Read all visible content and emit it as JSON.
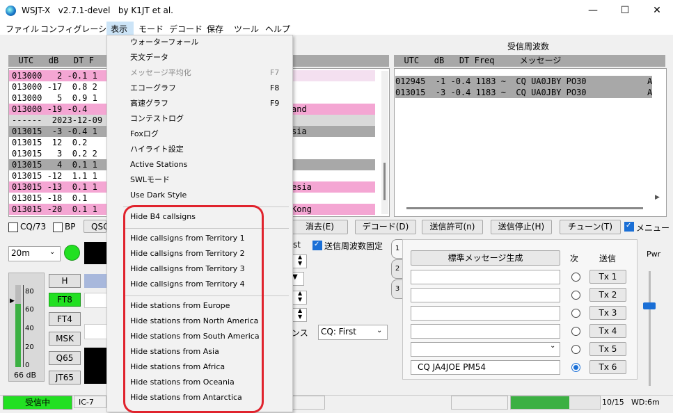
{
  "window": {
    "title": "WSJT-X   v2.7.1-devel   by K1JT et al.",
    "controls": [
      "—",
      "☐",
      "✕"
    ]
  },
  "menubar": [
    "ファイル",
    "コンフィグレーション",
    "表示",
    "モード",
    "デコード",
    "保存",
    "ツール",
    "ヘルプ"
  ],
  "band_activity": {
    "header": "  UTC   dB   DT F",
    "rows": [
      {
        "text": "013000   2 -0.1 1",
        "bg": "#f4a6d3"
      },
      {
        "text": "013000 -17  0.8 2",
        "bg": "#ffffff"
      },
      {
        "text": "013000   5  0.9 1",
        "bg": "#ffffff"
      },
      {
        "text": "013000 -19 -0.4  ",
        "bg": "#f4a6d3"
      },
      {
        "text": "------  2023-12-09",
        "bg": "#d9d9d9"
      },
      {
        "text": "013015  -3 -0.4 1",
        "bg": "#a8a8a8"
      },
      {
        "text": "013015  12  0.2  ",
        "bg": "#ffffff"
      },
      {
        "text": "013015   3  0.2 2",
        "bg": "#ffffff"
      },
      {
        "text": "013015   4  0.1 1",
        "bg": "#a8a8a8"
      },
      {
        "text": "013015 -12  1.1 1",
        "bg": "#ffffff"
      },
      {
        "text": "013015 -13  0.1 1",
        "bg": "#f4a6d3"
      },
      {
        "text": "013015 -18  0.1  ",
        "bg": "#ffffff"
      },
      {
        "text": "013015 -20  0.1 1",
        "bg": "#f4a6d3"
      }
    ],
    "right_fragments": [
      {
        "text": "",
        "bg": "#f4e0f0"
      },
      {
        "text": "",
        "bg": "#ffffff"
      },
      {
        "text": "",
        "bg": "#ffffff"
      },
      {
        "text": "and",
        "bg": "#f4a6d3"
      },
      {
        "text": "",
        "bg": "#d9d9d9"
      },
      {
        "text": "sia",
        "bg": "#a8a8a8"
      },
      {
        "text": "",
        "bg": "#ffffff"
      },
      {
        "text": "",
        "bg": "#ffffff"
      },
      {
        "text": "",
        "bg": "#a8a8a8"
      },
      {
        "text": "",
        "bg": "#ffffff"
      },
      {
        "text": "esia",
        "bg": "#f4a6d3"
      },
      {
        "text": "",
        "bg": "#ffffff"
      },
      {
        "text": "Kong",
        "bg": "#f4a6d3"
      }
    ]
  },
  "rx_frequency": {
    "title": "受信周波数",
    "header": "  UTC   dB   DT Freq     メッセージ",
    "rows": [
      "012945  -1 -0.4 1183 ~  CQ UA0JBY PO30",
      "013015  -3 -0.4 1183 ~  CQ UA0JBY PO30"
    ],
    "row_tail": "A"
  },
  "controls_row": {
    "cq73": "CQ/73",
    "bp": "BP",
    "qso": "QSC",
    "erase": "消去(E)",
    "decode": "デコード(D)",
    "enable_tx": "送信許可(n)",
    "halt_tx": "送信停止(H)",
    "tune": "チューン(T)",
    "menus": "メニュー"
  },
  "left_panel": {
    "band": "20m",
    "h_btn": "H",
    "modes": [
      "FT8",
      "FT4",
      "MSK",
      "Q65",
      "JT65"
    ],
    "meter_ticks": [
      "80",
      "60",
      "40",
      "20",
      "0"
    ],
    "meter_level_db": "66 dB",
    "meter_fill": 0.77
  },
  "middle": {
    "first_fragment": "st",
    "hold_tx_freq": "送信周波数固定",
    "sequence_fragment": "ンス",
    "cq_select": "CQ: First"
  },
  "tx_panel": {
    "tabs": [
      "1",
      "2",
      "3"
    ],
    "gen_msgs": "標準メッセージ生成",
    "next": "次",
    "send": "送信",
    "tx_buttons": [
      "Tx 1",
      "Tx 2",
      "Tx 3",
      "Tx 4",
      "Tx 5",
      "Tx 6"
    ],
    "tx6_message": "CQ JA4JOE PM54",
    "selected": 5,
    "pwr": "Pwr"
  },
  "statusbar": {
    "receiving": "受信中",
    "rig": "IC-7",
    "progress": "10/15",
    "progress_fill": 0.667,
    "wd": "WD:6m"
  },
  "view_menu": {
    "items": [
      {
        "label": "ウォーターフォール",
        "shortcut": "",
        "disabled": false
      },
      {
        "label": "天文データ",
        "shortcut": "",
        "disabled": false
      },
      {
        "label": "メッセージ平均化",
        "shortcut": "F7",
        "disabled": true
      },
      {
        "label": "エコーグラフ",
        "shortcut": "F8",
        "disabled": false
      },
      {
        "label": "高速グラフ",
        "shortcut": "F9",
        "disabled": false
      },
      {
        "label": "コンテストログ",
        "shortcut": "",
        "disabled": false
      },
      {
        "label": "Foxログ",
        "shortcut": "",
        "disabled": false
      },
      {
        "label": "ハイライト設定",
        "shortcut": "",
        "disabled": false
      },
      {
        "label": "Active Stations",
        "shortcut": "",
        "disabled": false
      },
      {
        "label": "SWLモード",
        "shortcut": "",
        "disabled": false
      },
      {
        "label": "Use Dark Style",
        "shortcut": "",
        "disabled": false
      }
    ],
    "hide_b4": "Hide B4 callsigns",
    "hide_territories": [
      "Hide callsigns from Territory 1",
      "Hide callsigns from Territory 2",
      "Hide callsigns from Territory 3",
      "Hide callsigns from Territory 4"
    ],
    "hide_continents": [
      "Hide stations from Europe",
      "Hide stations from North America",
      "Hide stations from South America",
      "Hide stations from Asia",
      "Hide stations from Africa",
      "Hide stations from Oceania",
      "Hide stations from Antarctica"
    ]
  }
}
